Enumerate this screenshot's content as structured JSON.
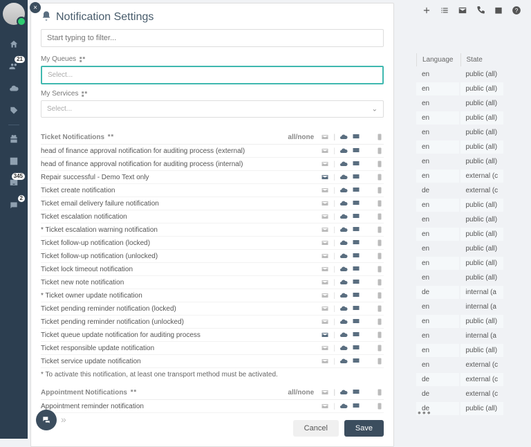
{
  "title": "Notification Settings",
  "filter_placeholder": "Start typing to filter...",
  "sections": {
    "queues": {
      "label": "My Queues",
      "placeholder": "Select..."
    },
    "services": {
      "label": "My Services",
      "placeholder": "Select..."
    }
  },
  "ticket_header": {
    "title": "Ticket Notifications",
    "allnone": "all/none"
  },
  "appt_header": {
    "title": "Appointment Notifications",
    "allnone": "all/none"
  },
  "ticket_rows": [
    "head of finance approval notification for auditing process (external)",
    "head of finance approval notification for auditing process (internal)",
    "Repair successful - Demo Text only",
    "Ticket create notification",
    "Ticket email delivery failure notification",
    "Ticket escalation notification",
    "* Ticket escalation warning notification",
    "Ticket follow-up notification (locked)",
    "Ticket follow-up notification (unlocked)",
    "Ticket lock timeout notification",
    "Ticket new note notification",
    "* Ticket owner update notification",
    "Ticket pending reminder notification (locked)",
    "Ticket pending reminder notification (unlocked)",
    "Ticket queue update notification for auditing process",
    "Ticket responsible update notification",
    "Ticket service update notification"
  ],
  "ticket_active_mail": {
    "2": true,
    "14": true
  },
  "footnote": "* To activate this notification, at least one transport method must be activated.",
  "appt_rows": [
    "Appointment reminder notification"
  ],
  "buttons": {
    "cancel": "Cancel",
    "save": "Save"
  },
  "sidebar_badges": {
    "contacts": "21",
    "inbox": "345",
    "chat": "2"
  },
  "bg_headers": {
    "lang": "Language",
    "state": "State"
  },
  "bg_rows": [
    {
      "lang": "en",
      "state": "public (all)"
    },
    {
      "lang": "en",
      "state": "public (all)"
    },
    {
      "lang": "en",
      "state": "public (all)"
    },
    {
      "lang": "en",
      "state": "public (all)"
    },
    {
      "lang": "en",
      "state": "public (all)"
    },
    {
      "lang": "en",
      "state": "public (all)"
    },
    {
      "lang": "en",
      "state": "public (all)"
    },
    {
      "lang": "en",
      "state": "external (c"
    },
    {
      "lang": "de",
      "state": "external (c"
    },
    {
      "lang": "en",
      "state": "public (all)"
    },
    {
      "lang": "en",
      "state": "public (all)"
    },
    {
      "lang": "en",
      "state": "public (all)"
    },
    {
      "lang": "en",
      "state": "public (all)"
    },
    {
      "lang": "en",
      "state": "public (all)"
    },
    {
      "lang": "en",
      "state": "public (all)"
    },
    {
      "lang": "de",
      "state": "internal (a"
    },
    {
      "lang": "en",
      "state": "internal (a"
    },
    {
      "lang": "en",
      "state": "public (all)"
    },
    {
      "lang": "en",
      "state": "internal (a"
    },
    {
      "lang": "en",
      "state": "public (all)"
    },
    {
      "lang": "en",
      "state": "external (c"
    },
    {
      "lang": "de",
      "state": "external (c"
    },
    {
      "lang": "de",
      "state": "external (c"
    },
    {
      "lang": "de",
      "state": "public (all)"
    }
  ]
}
